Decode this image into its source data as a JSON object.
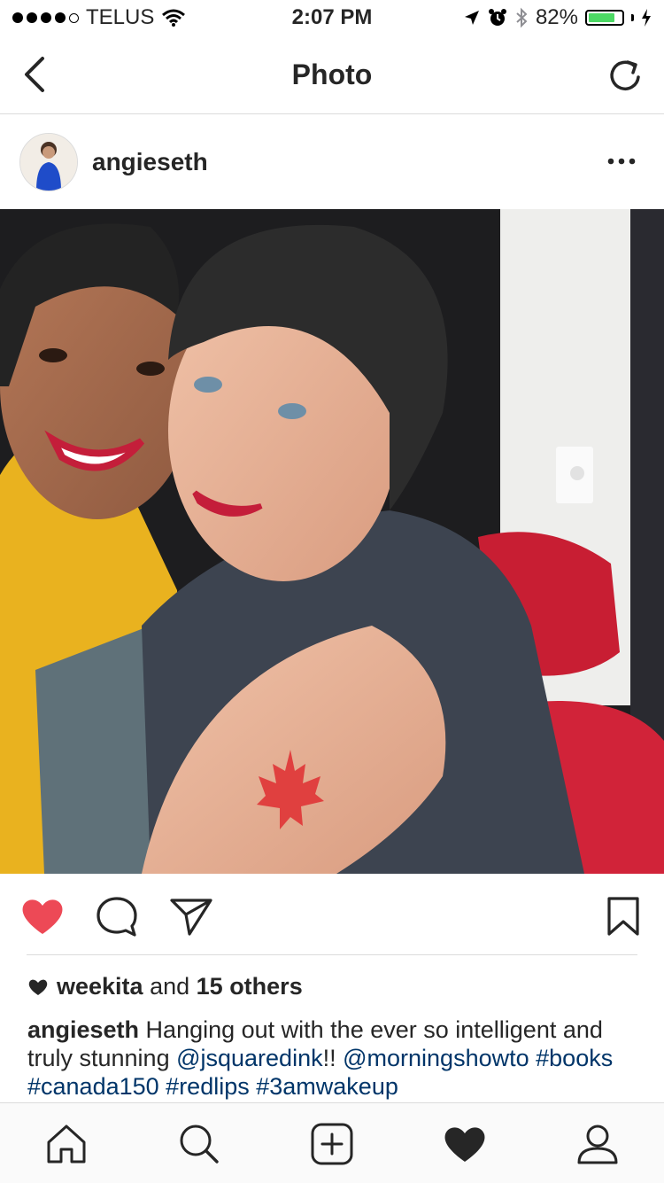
{
  "status_bar": {
    "carrier": "TELUS",
    "time": "2:07 PM",
    "battery_percent": "82%",
    "battery_level": 0.82,
    "icons": [
      "signal-dots",
      "wifi-icon",
      "location-arrow-icon",
      "alarm-icon",
      "bluetooth-icon",
      "battery-icon",
      "charging-bolt-icon"
    ]
  },
  "navbar": {
    "title": "Photo",
    "back_icon": "chevron-left-icon",
    "refresh_icon": "refresh-icon"
  },
  "post": {
    "username": "angieseth",
    "more_icon": "ellipsis-icon",
    "photo_icon": "photo",
    "liked": true,
    "likes": {
      "first_user": "weekita",
      "connector": "and",
      "others": "15 others"
    },
    "caption": {
      "user": "angieseth",
      "segments": [
        {
          "text": " Hanging out with the ever so intelligent and truly stunning ",
          "tag": false
        },
        {
          "text": "@jsquaredink",
          "tag": true
        },
        {
          "text": "!! ",
          "tag": false
        },
        {
          "text": "@morningshowto",
          "tag": true
        },
        {
          "text": " ",
          "tag": false
        },
        {
          "text": "#books",
          "tag": true
        },
        {
          "text": " ",
          "tag": false
        },
        {
          "text": "#canada150",
          "tag": true
        },
        {
          "text": " ",
          "tag": false
        },
        {
          "text": "#redlips",
          "tag": true
        },
        {
          "text": " ",
          "tag": false
        },
        {
          "text": "#3amwakeup",
          "tag": true
        }
      ]
    }
  },
  "actions": [
    "heart-icon",
    "comment-icon",
    "share-icon",
    "bookmark-icon"
  ],
  "tabbar": [
    "home-icon",
    "search-icon",
    "add-post-icon",
    "activity-heart-icon",
    "profile-icon"
  ],
  "colors": {
    "like_red": "#ed4956",
    "link_blue": "#003569",
    "text": "#262626",
    "divider": "#dbdbdb",
    "battery_green": "#4cd964"
  }
}
